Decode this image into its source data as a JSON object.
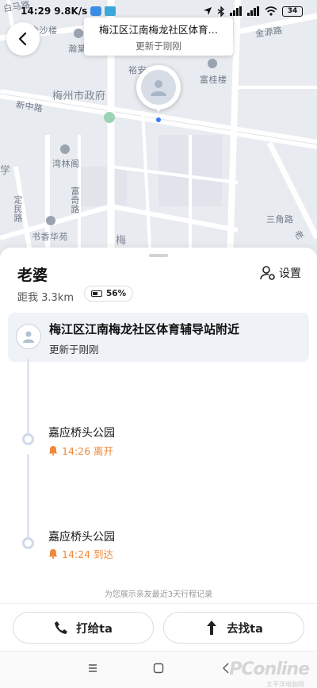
{
  "status_bar": {
    "time": "14:29",
    "speed": "9.8K/s",
    "battery": "34"
  },
  "map": {
    "callout_title": "梅江区江南梅龙社区体育…",
    "callout_sub": "更新于刚刚",
    "labels": [
      "白马路",
      "金沙楼",
      "瀚棠",
      "金源路",
      "裕安",
      "富桂楼",
      "新中路",
      "梅州市政府",
      "湾林阁",
      "学",
      "富奇路",
      "定民路",
      "书香华苑",
      "梅",
      "三角路",
      "老"
    ]
  },
  "sheet": {
    "name": "老婆",
    "settings_label": "设置",
    "distance": "距我 3.3km",
    "battery_pct": "56%",
    "current": {
      "place": "梅江区江南梅龙社区体育辅导站附近",
      "updated": "更新于刚刚"
    },
    "timeline": [
      {
        "place": "嘉应桥头公园",
        "time": "14:26 离开"
      },
      {
        "place": "嘉应桥头公园",
        "time": "14:24 到达"
      }
    ],
    "footnote": "为您展示亲友最近3天行程记录",
    "call_label": "打给ta",
    "go_label": "去找ta"
  },
  "watermark": {
    "brand": "PConline",
    "sub": "太平洋电脑网"
  },
  "colors": {
    "accent_orange": "#f0883a",
    "location_blue": "#2e7cf6",
    "map_bg": "#e8ebf0"
  }
}
